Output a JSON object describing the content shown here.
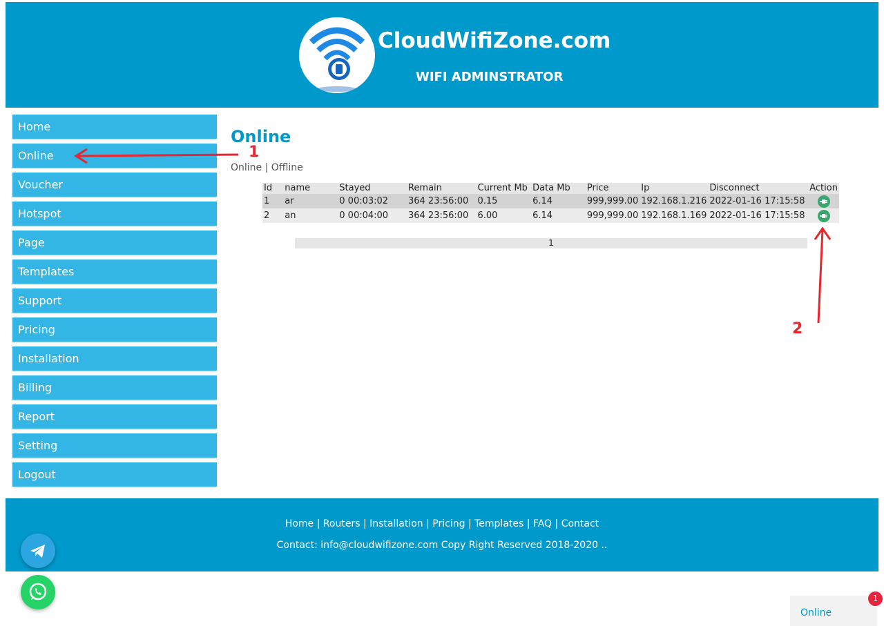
{
  "header": {
    "title": "CloudWifiZone.com",
    "subtitle": "WIFI ADMINSTRATOR"
  },
  "sidebar": {
    "items": [
      {
        "label": "Home"
      },
      {
        "label": "Online"
      },
      {
        "label": "Voucher"
      },
      {
        "label": "Hotspot"
      },
      {
        "label": "Page"
      },
      {
        "label": "Templates"
      },
      {
        "label": "Support"
      },
      {
        "label": "Pricing"
      },
      {
        "label": "Installation"
      },
      {
        "label": "Billing"
      },
      {
        "label": "Report"
      },
      {
        "label": "Setting"
      },
      {
        "label": "Logout"
      }
    ]
  },
  "main": {
    "heading": "Online",
    "sublinks": {
      "online": "Online",
      "separator": "|",
      "offline": "Offline"
    },
    "table": {
      "columns": [
        "Id",
        "name",
        "Stayed",
        "Remain",
        "Current Mb",
        "Data Mb",
        "Price",
        "Ip",
        "Disconnect",
        "Action"
      ],
      "rows": [
        {
          "id": "1",
          "name": "ar",
          "stayed": "0 00:03:02",
          "remain": "364 23:56:00",
          "current_mb": "0.15",
          "data_mb": "6.14",
          "price": "999,999.00",
          "ip": "192.168.1.216",
          "disconnect": "2022-01-16 17:15:58"
        },
        {
          "id": "2",
          "name": "an",
          "stayed": "0 00:04:00",
          "remain": "364 23:56:00",
          "current_mb": "6.00",
          "data_mb": "6.14",
          "price": "999,999.00",
          "ip": "192.168.1.169",
          "disconnect": "2022-01-16 17:15:58"
        }
      ]
    },
    "pagination": {
      "current_page": "1"
    }
  },
  "annotations": {
    "marker1": "1",
    "marker2": "2",
    "color": "#e8262e"
  },
  "footer": {
    "links": [
      "Home",
      "Routers",
      "Installation",
      "Pricing",
      "Templates",
      "FAQ",
      "Contact"
    ],
    "contact": "Contact: info@cloudwifizone.com Copy Right Reserved 2018-2020 .."
  },
  "status_widget": {
    "label": "Online",
    "badge_count": "1"
  },
  "colors": {
    "brand": "#0099cc",
    "nav": "#33b5e5",
    "action_green": "#3aa66e",
    "badge": "#e8243c"
  },
  "icons": {
    "telegram": "telegram-icon",
    "whatsapp": "whatsapp-icon",
    "disconnect": "plug-icon",
    "logo": "wifi-lock-logo"
  }
}
